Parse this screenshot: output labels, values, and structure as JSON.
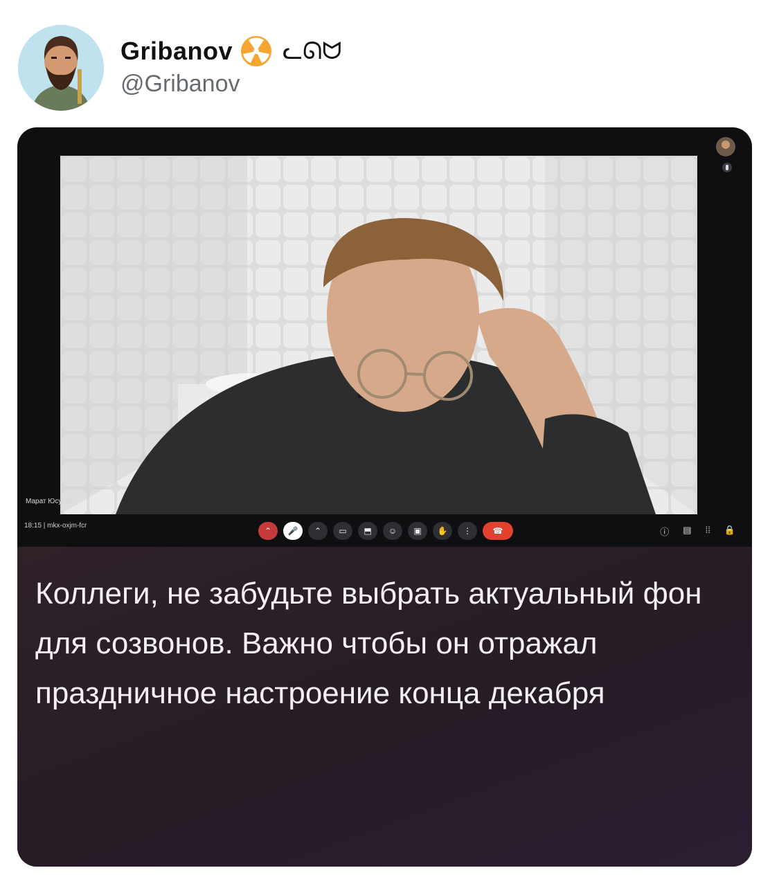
{
  "post": {
    "display_name": "Gribanov",
    "handle": "@Gribanov",
    "name_suffix": "ᓚᘏᗢ",
    "badge_icon": "radioactive-emoji",
    "avatar_icon": "bearded-man-portrait"
  },
  "video_call": {
    "participant_name": "Марат Юсупов",
    "meeting_info": "18:15 | mkx-oxjm-fcr",
    "controls": [
      {
        "icon": "chevron-up-icon"
      },
      {
        "icon": "mic-off-icon"
      },
      {
        "icon": "chevron-up-icon"
      },
      {
        "icon": "camera-icon"
      },
      {
        "icon": "present-icon"
      },
      {
        "icon": "emoji-icon"
      },
      {
        "icon": "captions-icon"
      },
      {
        "icon": "raise-hand-icon"
      },
      {
        "icon": "more-options-icon"
      },
      {
        "icon": "end-call-icon"
      }
    ],
    "right_tools": [
      {
        "icon": "info-icon"
      },
      {
        "icon": "chat-icon"
      },
      {
        "icon": "activities-icon"
      },
      {
        "icon": "host-controls-icon"
      }
    ]
  },
  "caption": {
    "text": "Коллеги, не забудьте выбрать актуальный фон для созвонов. Важно чтобы он отражал праздничное настроение конца декабря"
  }
}
